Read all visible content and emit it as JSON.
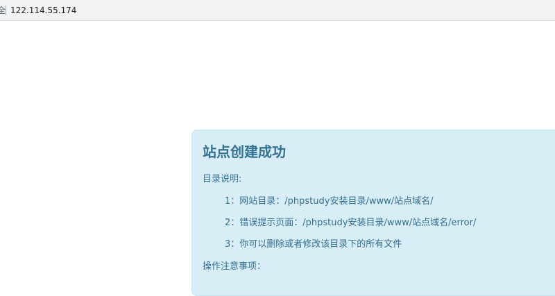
{
  "browser": {
    "address_prefix": "全",
    "url": "122.114.55.174"
  },
  "panel": {
    "title": "站点创建成功",
    "dir_heading": "目录说明:",
    "items": [
      "1：网站目录：/phpstudy安装目录/www/站点域名/",
      "2：错误提示页面：/phpstudy安装目录/www/站点域名/error/",
      "3：你可以删除或者修改该目录下的所有文件"
    ],
    "notes_heading": "操作注意事项："
  },
  "colors": {
    "panel_background": "#d9edf7",
    "panel_text": "#31708f",
    "address_bar": "#f1f3f4"
  }
}
